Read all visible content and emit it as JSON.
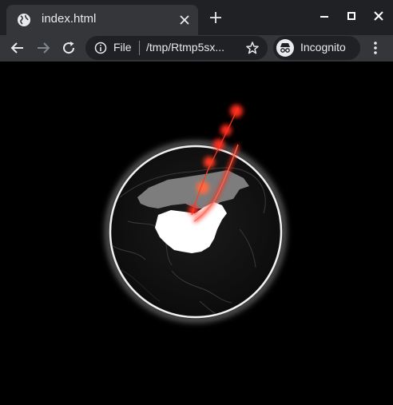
{
  "browser": {
    "tab_title": "index.html",
    "address_scheme": "File",
    "address_path": "/tmp/Rtmp5sx...",
    "profile_label": "Incognito"
  },
  "icons": {
    "favicon": "globe-icon",
    "tab_close": "close-icon",
    "new_tab": "plus-icon",
    "minimize": "minimize-icon",
    "maximize": "maximize-icon",
    "close_window": "close-icon",
    "back": "arrow-left-icon",
    "forward": "arrow-right-icon",
    "reload": "reload-icon",
    "site_info": "info-icon",
    "bookmark": "star-icon",
    "incognito": "incognito-icon",
    "menu": "kebab-menu-icon"
  },
  "colors": {
    "tab_strip": "#202124",
    "toolbar": "#35363a",
    "page_background": "#000000",
    "highlight_country": "#ffffff",
    "secondary_country": "#808080",
    "arc": "#ff2a1a"
  }
}
